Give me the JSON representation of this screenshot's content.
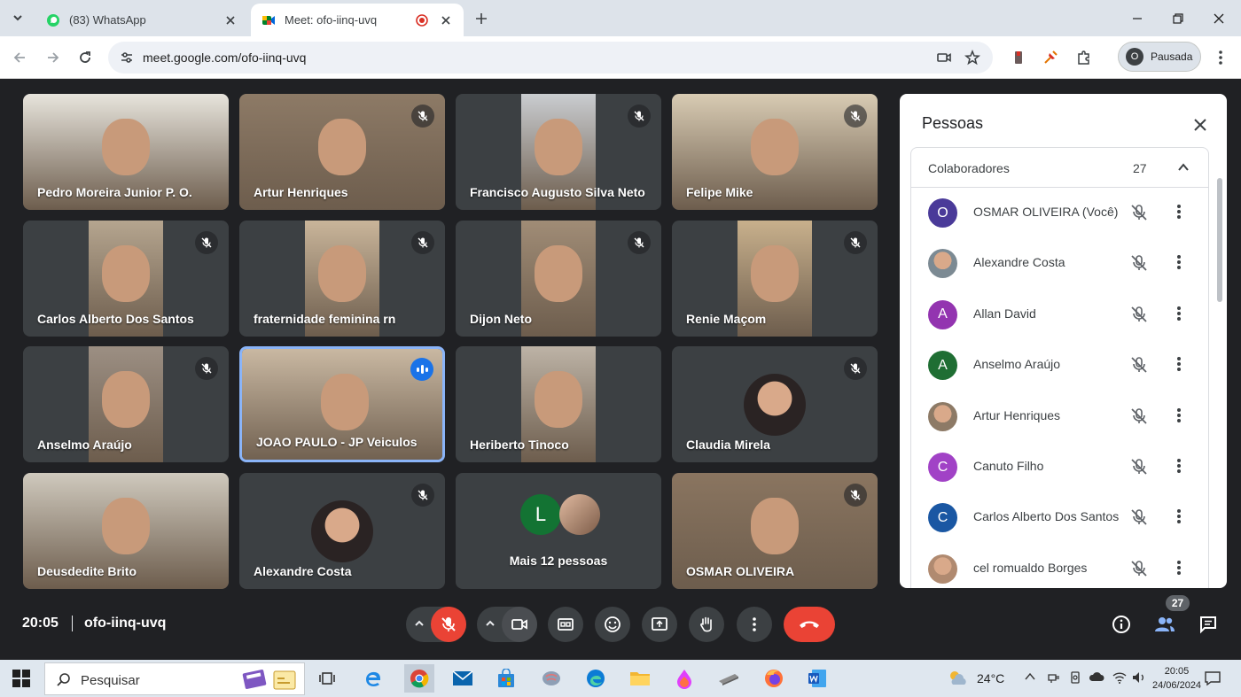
{
  "browser": {
    "tabs": [
      {
        "title": "(83) WhatsApp",
        "icon": "whatsapp-icon"
      },
      {
        "title": "Meet: ofo-iinq-uvq",
        "icon": "google-meet-icon",
        "recording": true
      }
    ],
    "url": "meet.google.com/ofo-iinq-uvq",
    "profile": {
      "initial": "O",
      "label": "Pausada"
    }
  },
  "meet": {
    "tiles": [
      {
        "name": "Pedro Moreira Junior P. O.",
        "muted": false,
        "bg": "#e7e4dc"
      },
      {
        "name": "Artur Henriques",
        "muted": true,
        "bg": "#8d7a66"
      },
      {
        "name": "Francisco Augusto Silva Neto",
        "muted": true,
        "bg": "#c9ccd0"
      },
      {
        "name": "Felipe Mike",
        "muted": true,
        "bg": "#d8cbb3"
      },
      {
        "name": "Carlos Alberto Dos Santos",
        "muted": true,
        "bg": "#b5a58f"
      },
      {
        "name": "fraternidade feminina rn",
        "muted": true,
        "bg": "#c9b59a"
      },
      {
        "name": "Dijon Neto",
        "muted": true,
        "bg": "#a08c76"
      },
      {
        "name": "Renie Maçom",
        "muted": true,
        "bg": "#c8b08c"
      },
      {
        "name": "Anselmo Araújo",
        "muted": true,
        "bg": "#9c8f83"
      },
      {
        "name": "JOAO PAULO - JP Veiculos",
        "muted": false,
        "speaking": true,
        "bg": "#c9b8a2"
      },
      {
        "name": "Heriberto Tinoco",
        "muted": false,
        "bg": "#bdb3a6"
      },
      {
        "name": "Claudia Mirela",
        "muted": true,
        "bg": "#3c4043"
      },
      {
        "name": "Deusdedite Brito",
        "muted": false,
        "bg": "#cfc9bd"
      },
      {
        "name": "Alexandre Costa",
        "muted": true,
        "bg": "#3c4043"
      },
      {
        "name": "Mais 12 pessoas",
        "muted": false,
        "bg": "#3c4043",
        "avatar_letter": "L"
      },
      {
        "name": "OSMAR OLIVEIRA",
        "muted": true,
        "bg": "#8a7560"
      }
    ],
    "people_panel": {
      "title": "Pessoas",
      "section_label": "Colaboradores",
      "count": "27",
      "people": [
        {
          "name": "OSMAR OLIVEIRA (Você)",
          "initial": "O",
          "color": "#4a3a99"
        },
        {
          "name": "Alexandre Costa",
          "initial": "",
          "color": "#7c8a93"
        },
        {
          "name": "Allan David",
          "initial": "A",
          "color": "#9334b0"
        },
        {
          "name": "Anselmo Araújo",
          "initial": "A",
          "color": "#1f6e33"
        },
        {
          "name": "Artur Henriques",
          "initial": "",
          "color": "#8d7a66"
        },
        {
          "name": "Canuto Filho",
          "initial": "C",
          "color": "#a142c6"
        },
        {
          "name": "Carlos Alberto Dos Santos",
          "initial": "C",
          "color": "#1a57a3"
        },
        {
          "name": "cel romualdo Borges",
          "initial": "",
          "color": "#b08a70"
        }
      ]
    },
    "bottom": {
      "time": "20:05",
      "code": "ofo-iinq-uvq",
      "participants_badge": "27"
    }
  },
  "taskbar": {
    "search_placeholder": "Pesquisar",
    "weather": "24°C",
    "time": "20:05",
    "date": "24/06/2024"
  },
  "colors": {
    "accent": "#1a73e8",
    "end_call": "#ea4335",
    "meet_bg": "#202124",
    "tile_bg": "#3c4043"
  }
}
